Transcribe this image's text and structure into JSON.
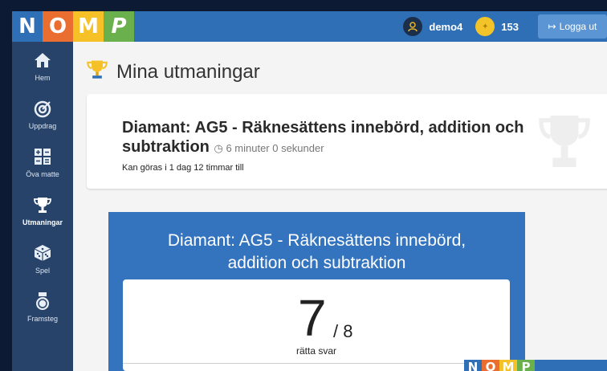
{
  "logo": {
    "letters": [
      "N",
      "O",
      "M",
      "P"
    ],
    "colors": [
      "#2f6fb6",
      "#e96e2f",
      "#f5c126",
      "#6ab04c"
    ]
  },
  "header": {
    "username": "demo4",
    "coins": "153",
    "logout_label": "Logga ut",
    "logout_icon": "sign-out-icon"
  },
  "sidebar": {
    "items": [
      {
        "label": "Hem",
        "icon": "home-icon"
      },
      {
        "label": "Uppdrag",
        "icon": "target-icon"
      },
      {
        "label": "Öva matte",
        "icon": "calculator-icon"
      },
      {
        "label": "Utmaningar",
        "icon": "trophy-icon",
        "active": true
      },
      {
        "label": "Spel",
        "icon": "dice-icon"
      },
      {
        "label": "Framsteg",
        "icon": "medal-icon"
      }
    ]
  },
  "page": {
    "title": "Mina utmaningar"
  },
  "challenge": {
    "title": "Diamant: AG5 - Räknesättens innebörd, addition och subtraktion",
    "duration": "6 minuter 0 sekunder",
    "availability": "Kan göras i 1 dag 12 timmar till"
  },
  "result": {
    "title_line1": "Diamant: AG5 - Räknesättens innebörd,",
    "title_line2": "addition och subtraktion",
    "score": "7",
    "total": "/ 8",
    "label": "rätta svar"
  }
}
